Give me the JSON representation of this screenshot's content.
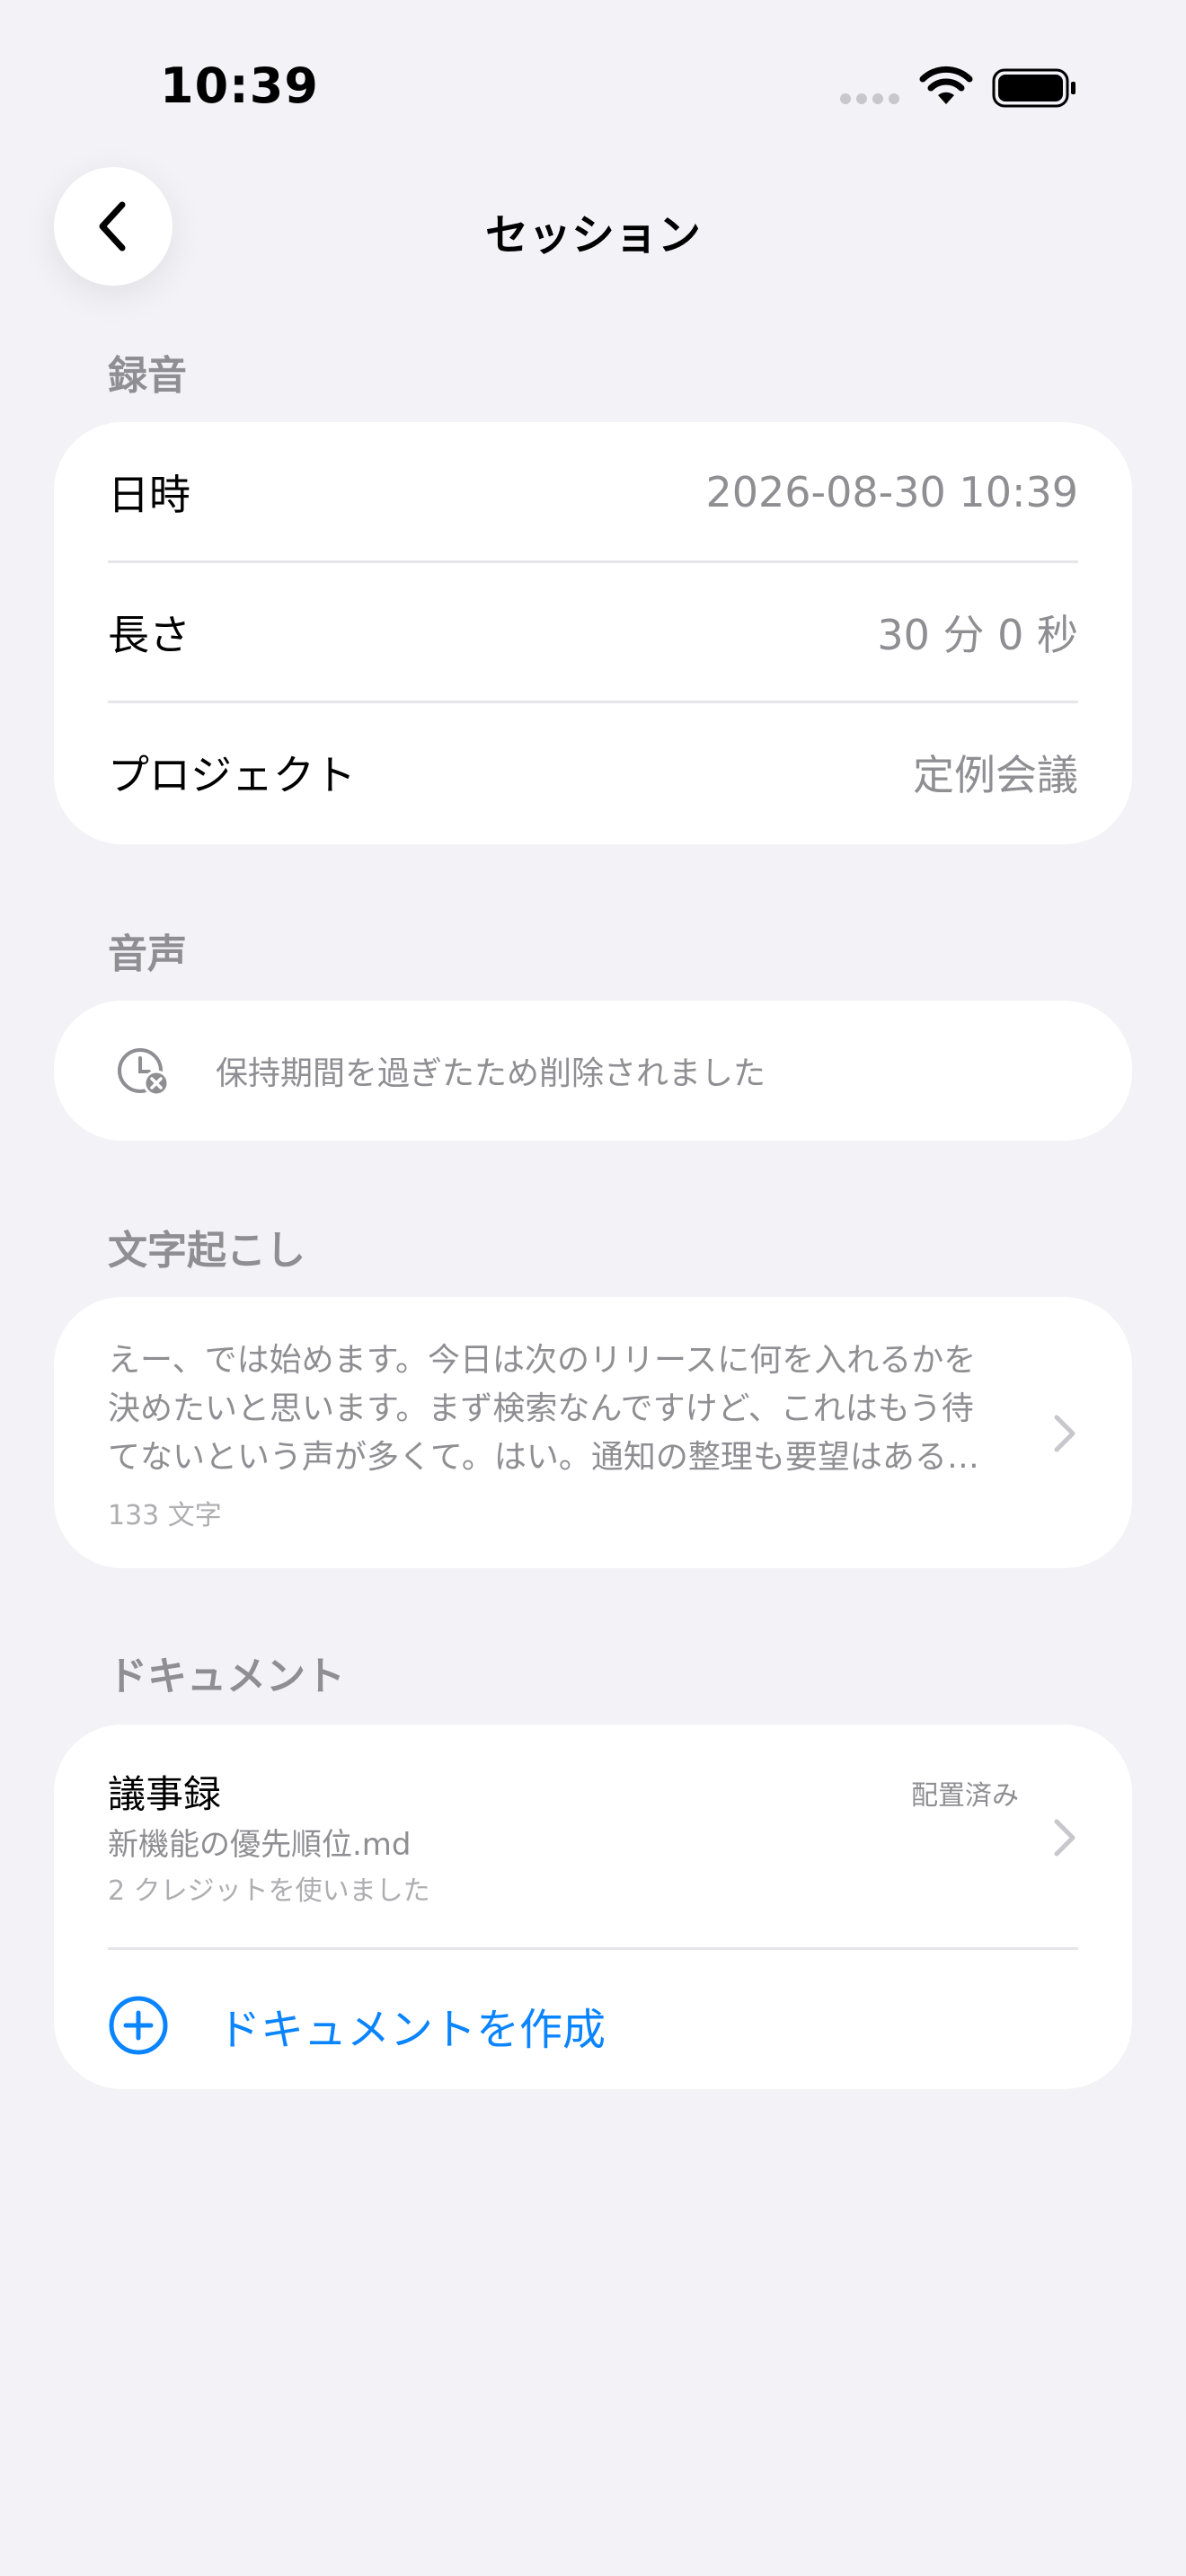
{
  "status_bar": {
    "time": "10:39"
  },
  "nav": {
    "title": "セッション"
  },
  "recording": {
    "header": "録音",
    "rows": [
      {
        "label": "日時",
        "value": "2026-08-30 10:39"
      },
      {
        "label": "長さ",
        "value": "30 分 0 秒"
      },
      {
        "label": "プロジェクト",
        "value": "定例会議"
      }
    ]
  },
  "audio": {
    "header": "音声",
    "message": "保持期間を過ぎたため削除されました",
    "icon": "clock-deleted-icon"
  },
  "transcript": {
    "header": "文字起こし",
    "lines": [
      "えー、では始めます。今日は次のリリースに何を入れるかを",
      "決めたいと思います。まず検索なんですけど、これはもう待",
      "てないという声が多くて。はい。通知の整理も要望はある…"
    ],
    "count": "133 文字"
  },
  "documents": {
    "header": "ドキュメント",
    "items": [
      {
        "title": "議事録",
        "file": "新機能の優先順位.md",
        "credits": "2 クレジットを使いました",
        "badge": "配置済み"
      }
    ],
    "create_label": "ドキュメントを作成"
  },
  "colors": {
    "accent": "#0A84FF",
    "background": "#F2F2F7",
    "secondary": "#8E8E93"
  }
}
